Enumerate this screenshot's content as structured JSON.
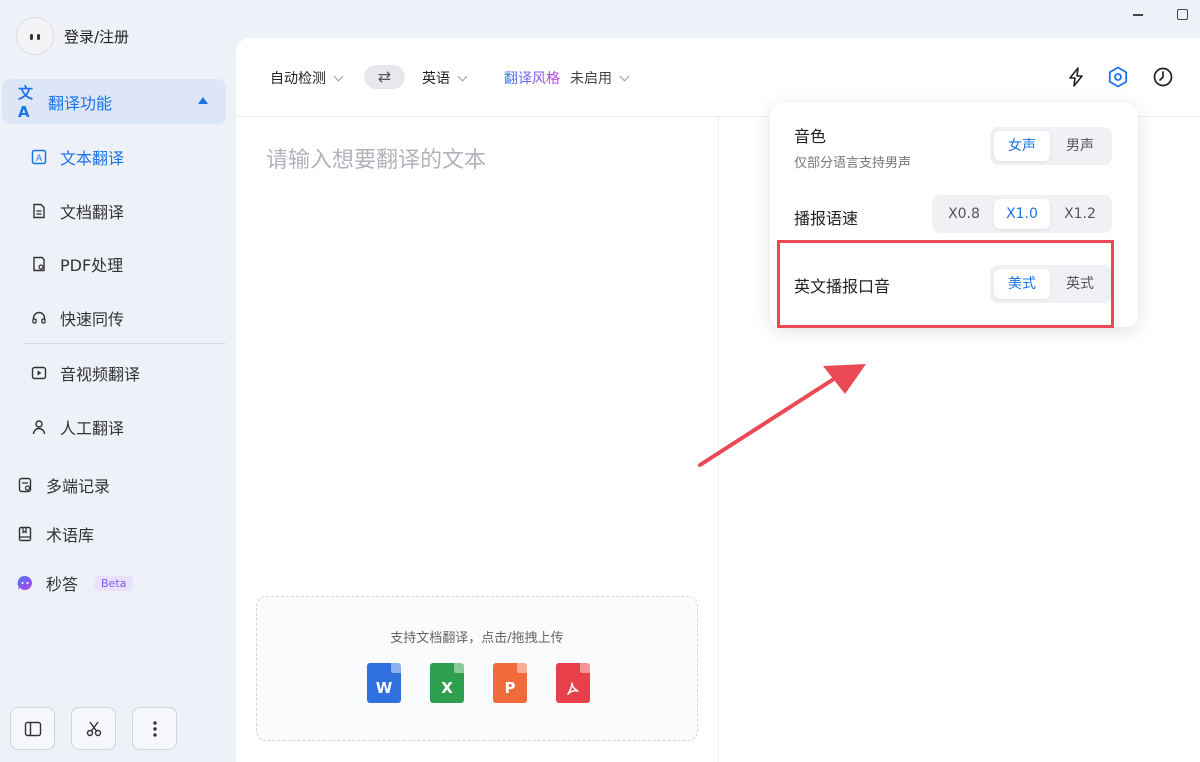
{
  "user": {
    "login_label": "登录/注册"
  },
  "sidebar": {
    "group": {
      "label": "翻译功能"
    },
    "sub_items": [
      {
        "label": "文本翻译"
      },
      {
        "label": "文档翻译"
      },
      {
        "label": "PDF处理"
      },
      {
        "label": "快速同传"
      },
      {
        "label": "音视频翻译"
      },
      {
        "label": "人工翻译"
      }
    ],
    "items": [
      {
        "label": "多端记录"
      },
      {
        "label": "术语库"
      },
      {
        "label": "秒答",
        "badge": "Beta"
      }
    ]
  },
  "toolbar": {
    "source_lang": "自动检测",
    "swap_icon": "⇄",
    "target_lang": "英语",
    "style_label": "翻译风格",
    "style_value": "未启用"
  },
  "editor": {
    "placeholder": "请输入想要翻译的文本"
  },
  "upload": {
    "hint": "支持文档翻译，点击/拖拽上传",
    "file_types": [
      {
        "letter": "W",
        "color": "#2f6fde"
      },
      {
        "letter": "X",
        "color": "#2e9e4f"
      },
      {
        "letter": "P",
        "color": "#f06a3c"
      },
      {
        "letter": "",
        "color": "#e8404a"
      }
    ]
  },
  "settings_popup": {
    "voice": {
      "label": "音色",
      "sub": "仅部分语言支持男声",
      "options": [
        "女声",
        "男声"
      ],
      "selected": "女声"
    },
    "speed": {
      "label": "播报语速",
      "options": [
        "X0.8",
        "X1.0",
        "X1.2"
      ],
      "selected": "X1.0"
    },
    "accent": {
      "label": "英文播报口音",
      "options": [
        "美式",
        "英式"
      ],
      "selected": "美式"
    }
  },
  "colors": {
    "accent": "#1b73e8",
    "highlight": "#ea4a55"
  }
}
